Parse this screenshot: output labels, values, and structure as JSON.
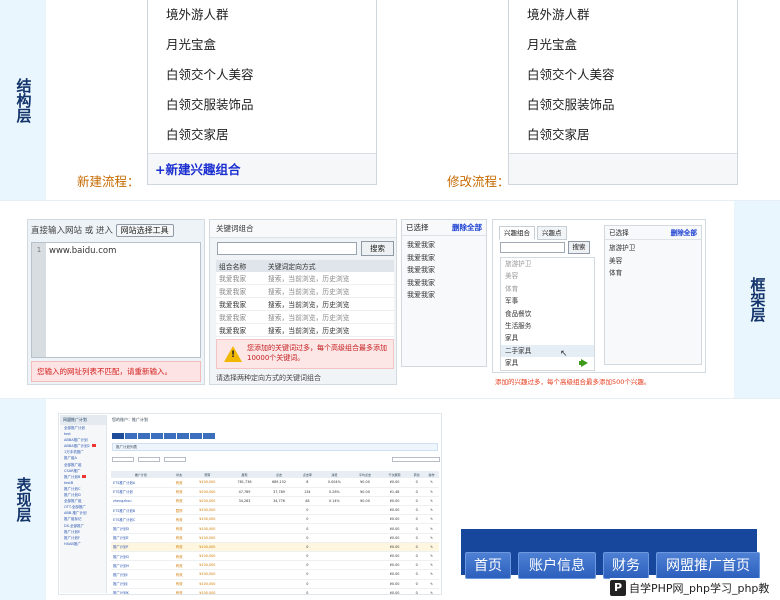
{
  "sections": {
    "structure": "结构层",
    "framework": "框架层",
    "presentation": "表现层"
  },
  "band1": {
    "new_flow_label": "新建流程：",
    "edit_flow_label": "修改流程：",
    "left_panel": {
      "items": [
        "境外游人群",
        "月光宝盒",
        "白领交个人美容",
        "白领交服装饰品",
        "白领交家居"
      ],
      "footer_link": "+新建兴趣组合"
    },
    "right_panel": {
      "items": [
        "境外游人群",
        "月光宝盒",
        "白领交个人美容",
        "白领交服装饰品",
        "白领交家居"
      ]
    }
  },
  "band2": {
    "url_panel": {
      "prompt": "直接输入网站 或 进入",
      "tool_button": "网站选择工具",
      "line_number": "1",
      "url_value": "www.baidu.com",
      "error": "您输入的网址列表不匹配，请重新输入。"
    },
    "keyword_panel": {
      "title": "关键词组合",
      "search_button": "搜索",
      "columns": [
        "组合名称",
        "关键词定向方式"
      ],
      "rows": [
        {
          "name": "我爱我家",
          "method": "搜索，当前浏览，历史浏览",
          "bold": false
        },
        {
          "name": "我爱我家",
          "method": "搜索，当前浏览，历史浏览",
          "bold": false
        },
        {
          "name": "我爱我家",
          "method": "搜索，当前浏览，历史浏览",
          "bold": true
        },
        {
          "name": "我爱我家",
          "method": "搜索，当前浏览，历史浏览",
          "bold": false
        },
        {
          "name": "我爱我家",
          "method": "搜索，当前浏览，历史浏览",
          "bold": true
        },
        {
          "name": "我爱我家",
          "method": "搜索，当前浏览，历史浏览",
          "bold": true
        }
      ],
      "warning_icon_text": "!",
      "warning": "您添加的关键词过多，每个高级组合最多添加10000个关键词。",
      "bottom_note": "请选择两种定向方式的关键词组合"
    },
    "selected_panel": {
      "title": "已选择",
      "delete_all": "删除全部",
      "items": [
        "我爱我家",
        "我爱我家",
        "我爱我家",
        "我爱我家",
        "我爱我家"
      ]
    },
    "interest_panel": {
      "tabs": [
        "兴趣组合",
        "兴趣点"
      ],
      "search_button": "搜索",
      "items": [
        "旅游护卫",
        "美容",
        "体育",
        "军事",
        "食品餐饮",
        "生活服务",
        "家具",
        "二手家具",
        "家具"
      ],
      "grey_items": [
        0,
        1,
        2
      ],
      "selected_item": 7,
      "selected_title": "已选择",
      "delete_all": "删除全部",
      "selected": [
        "旅游护卫",
        "美容",
        "体育"
      ],
      "message": "添加的兴趣过多，每个高级组合最多添加500个兴趣。"
    }
  },
  "band3": {
    "nav_items": [
      "首页",
      "账户信息",
      "财务",
      "网盟推广首页"
    ],
    "watermark": "自学PHP网_php学习_php教",
    "watermark_logo": "P",
    "mini": {
      "tree_header": "网盟推广计划",
      "tree_items": [
        "全部推广计划",
        "test",
        "ABBA推广计划",
        "ABBA推广计划2",
        "1万手机推广",
        "推广组A",
        "全部推广组",
        "CSAR推广",
        "推广计划B",
        "testB",
        "推广计划C",
        "推广计划D",
        "全部推广组",
        "OTT-全部推广",
        "ABB-推广计划",
        "推广组标记",
        "DS-全部推广",
        "推广计划E",
        "推广计划F",
        "HXAB推广"
      ],
      "head": "您的账户：推广计划",
      "note": "推广计划列表",
      "columns": [
        "推广计划",
        "状态",
        "预算",
        "展现",
        "点击",
        "点击率",
        "消费",
        "平均点击",
        "千次展现",
        "转化",
        "操作"
      ],
      "rows": [
        [
          "ETS推广计划A",
          "有效",
          "¥100,000",
          "781,736",
          "689,152",
          "8",
          "0.004%",
          "¥0.00",
          "¥0.00",
          "0",
          "✎"
        ],
        [
          "ETS推广计划",
          "有效",
          "¥200,000",
          "47,789",
          "37,789",
          "134",
          "0.28%",
          "¥0.00",
          "¥1.48",
          "0",
          "✎"
        ],
        [
          "zhengzhou",
          "有效",
          "¥200,000",
          "34,283",
          "34,776",
          "48",
          "0.14%",
          "¥0.00",
          "¥0.00",
          "0",
          "✎"
        ],
        [
          "ETS推广计划B",
          "暂停",
          "¥100,000",
          "",
          "",
          "0",
          "",
          "",
          "¥0.00",
          "0",
          "✎"
        ],
        [
          "ETS推广计划C",
          "有效",
          "¥100,000",
          "",
          "",
          "0",
          "",
          "",
          "¥0.00",
          "0",
          "✎"
        ],
        [
          "推广计划D",
          "有效",
          "¥100,000",
          "",
          "",
          "0",
          "",
          "",
          "¥0.00",
          "0",
          "✎"
        ],
        [
          "推广计划E",
          "有效",
          "¥100,000",
          "",
          "",
          "0",
          "",
          "",
          "¥0.00",
          "0",
          "✎"
        ],
        [
          "推广计划F",
          "有效",
          "¥100,000",
          "",
          "",
          "0",
          "",
          "",
          "¥0.00",
          "0",
          "✎"
        ],
        [
          "推广计划G",
          "有效",
          "¥100,000",
          "",
          "",
          "0",
          "",
          "",
          "¥0.00",
          "0",
          "✎"
        ],
        [
          "推广计划H",
          "有效",
          "¥100,000",
          "",
          "",
          "0",
          "",
          "",
          "¥0.00",
          "0",
          "✎"
        ],
        [
          "推广计划I",
          "有效",
          "¥100,000",
          "",
          "",
          "0",
          "",
          "",
          "¥0.00",
          "0",
          "✎"
        ],
        [
          "推广计划J",
          "有效",
          "¥100,000",
          "",
          "",
          "0",
          "",
          "",
          "¥0.00",
          "0",
          "✎"
        ],
        [
          "推广计划K",
          "有效",
          "¥100,000",
          "",
          "",
          "0",
          "",
          "",
          "¥0.00",
          "0",
          "✎"
        ],
        [
          "推广计划L",
          "有效",
          "¥100,000",
          "",
          "",
          "0",
          "",
          "",
          "¥0.00",
          "0",
          "✎"
        ]
      ]
    }
  },
  "colors": {
    "side_bg": "#e9f6fd",
    "side_text": "#13336b",
    "flow_label": "#c66a00",
    "link_blue": "#1b2fd0",
    "nav_bg": "#17469d"
  }
}
